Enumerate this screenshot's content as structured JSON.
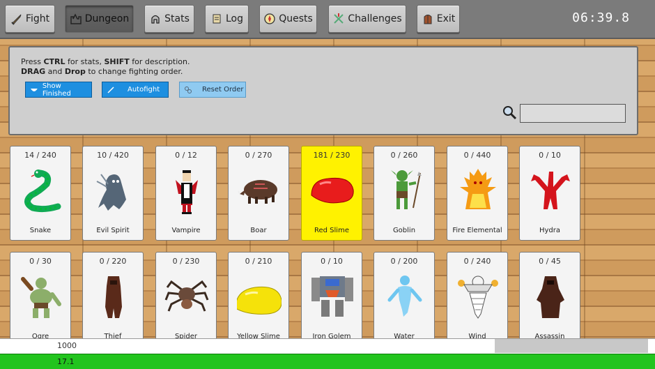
{
  "nav": {
    "fight": "Fight",
    "dungeon": "Dungeon",
    "stats": "Stats",
    "log": "Log",
    "quests": "Quests",
    "challenges": "Challenges",
    "exit": "Exit"
  },
  "timer": "06:39.8",
  "help": {
    "line1_a": "Press ",
    "line1_ctrl": "CTRL",
    "line1_b": " for stats, ",
    "line1_shift": "SHIFT",
    "line1_c": " for description.",
    "line2_drag": "DRAG",
    "line2_a": " and ",
    "line2_drop": "Drop",
    "line2_b": " to change fighting order."
  },
  "controls": {
    "show_finished": "Show Finished",
    "autofight": "Autofight",
    "reset_order": "Reset Order"
  },
  "search": {
    "value": "",
    "placeholder": ""
  },
  "monsters": [
    {
      "name": "Snake",
      "count": "14 / 240",
      "icon": "snake-icon"
    },
    {
      "name": "Evil Spirit",
      "count": "10 / 420",
      "icon": "evil-spirit-icon"
    },
    {
      "name": "Vampire",
      "count": "0 / 12",
      "icon": "vampire-icon"
    },
    {
      "name": "Boar",
      "count": "0 / 270",
      "icon": "boar-icon"
    },
    {
      "name": "Red Slime",
      "count": "181 / 230",
      "icon": "red-slime-icon",
      "highlight": true
    },
    {
      "name": "Goblin",
      "count": "0 / 260",
      "icon": "goblin-icon"
    },
    {
      "name": "Fire Elemental",
      "count": "0 / 440",
      "icon": "fire-elemental-icon"
    },
    {
      "name": "Hydra",
      "count": "0 / 10",
      "icon": "hydra-icon"
    },
    {
      "name": "Ogre",
      "count": "0 / 30",
      "icon": "ogre-icon"
    },
    {
      "name": "Thief",
      "count": "0 / 220",
      "icon": "thief-icon"
    },
    {
      "name": "Spider",
      "count": "0 / 230",
      "icon": "spider-icon"
    },
    {
      "name": "Yellow Slime",
      "count": "0 / 210",
      "icon": "yellow-slime-icon"
    },
    {
      "name": "Iron Golem",
      "count": "0 / 10",
      "icon": "iron-golem-icon"
    },
    {
      "name": "Water",
      "count": "0 / 200",
      "icon": "water-elemental-icon"
    },
    {
      "name": "Wind",
      "count": "0 / 240",
      "icon": "wind-elemental-icon"
    },
    {
      "name": "Assassin",
      "count": "0 / 45",
      "icon": "assassin-icon"
    }
  ],
  "bars": {
    "white_value": "1000",
    "white_fill": 0.755,
    "green_value": "17.1",
    "green_fill": 1.0
  },
  "colors": {
    "highlight": "#fff200",
    "button_blue": "#1e8fe0",
    "progress_green": "#22c41e"
  }
}
